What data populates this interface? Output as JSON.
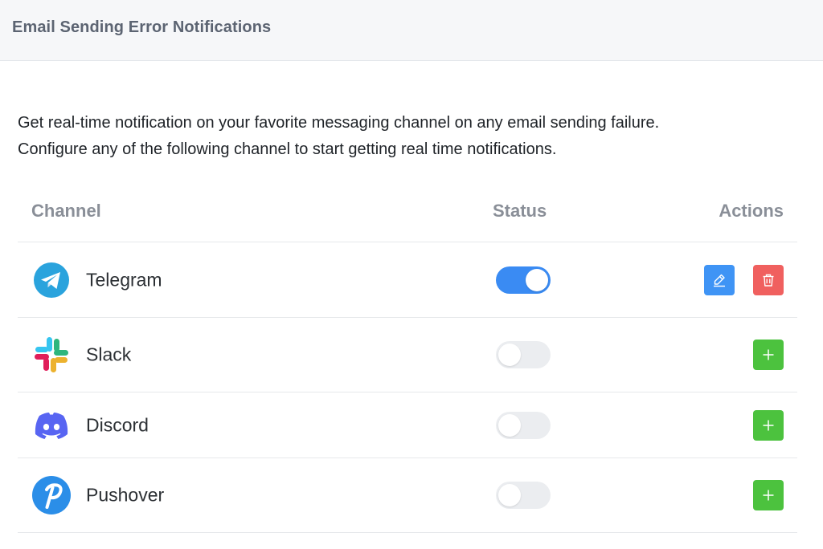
{
  "header": {
    "title": "Email Sending Error Notifications"
  },
  "description": {
    "line1": "Get real-time notification on your favorite messaging channel on any email sending failure.",
    "line2": "Configure any of the following channel to start getting real time notifications."
  },
  "table": {
    "columns": {
      "channel": "Channel",
      "status": "Status",
      "actions": "Actions"
    },
    "rows": [
      {
        "name": "Telegram",
        "icon": "telegram-icon",
        "enabled": true,
        "actions": [
          "edit",
          "delete"
        ]
      },
      {
        "name": "Slack",
        "icon": "slack-icon",
        "enabled": false,
        "actions": [
          "add"
        ]
      },
      {
        "name": "Discord",
        "icon": "discord-icon",
        "enabled": false,
        "actions": [
          "add"
        ]
      },
      {
        "name": "Pushover",
        "icon": "pushover-icon",
        "enabled": false,
        "actions": [
          "add"
        ]
      }
    ]
  },
  "colors": {
    "toggle_on": "#3a8bf3",
    "toggle_off": "#ebedf0",
    "edit_button": "#3f94f5",
    "delete_button": "#f0605f",
    "add_button": "#4cc23e",
    "telegram": "#2aa3dd",
    "discord": "#5865f2",
    "pushover": "#2b8ee8"
  }
}
